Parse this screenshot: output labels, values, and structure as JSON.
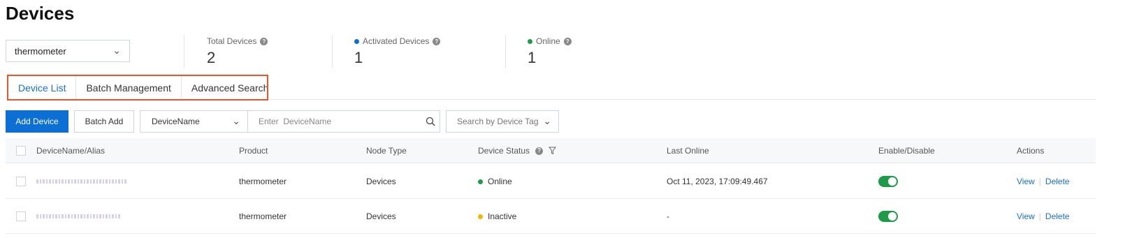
{
  "page": {
    "title": "Devices"
  },
  "product_select": {
    "value": "thermometer"
  },
  "stats": [
    {
      "label": "Total Devices",
      "value": "2",
      "dot_color": ""
    },
    {
      "label": "Activated Devices",
      "value": "1",
      "dot_color": "#0b6fd3"
    },
    {
      "label": "Online",
      "value": "1",
      "dot_color": "#1e9b49"
    }
  ],
  "tabs": [
    {
      "label": "Device List",
      "active": true
    },
    {
      "label": "Batch Management",
      "active": false
    },
    {
      "label": "Advanced Search",
      "active": false
    }
  ],
  "toolbar": {
    "add_device": "Add Device",
    "batch_add": "Batch Add",
    "field_select": "DeviceName",
    "search_placeholder": "Enter  DeviceName",
    "tag_placeholder": "Search by Device Tag"
  },
  "table": {
    "columns": {
      "name": "DeviceName/Alias",
      "product": "Product",
      "node_type": "Node Type",
      "status": "Device Status",
      "last_online": "Last Online",
      "enable": "Enable/Disable",
      "actions": "Actions"
    },
    "rows": [
      {
        "product": "thermometer",
        "node_type": "Devices",
        "status": "Online",
        "status_color": "#1e9b49",
        "last_online": "Oct 11, 2023, 17:09:49.467",
        "enabled": true,
        "view": "View",
        "delete": "Delete"
      },
      {
        "product": "thermometer",
        "node_type": "Devices",
        "status": "Inactive",
        "status_color": "#f5b400",
        "last_online": "-",
        "enabled": true,
        "view": "View",
        "delete": "Delete"
      }
    ]
  },
  "colors": {
    "accent": "#0b6fd3",
    "highlight_border": "#e8542b",
    "online": "#1e9b49",
    "inactive": "#f5b400"
  }
}
